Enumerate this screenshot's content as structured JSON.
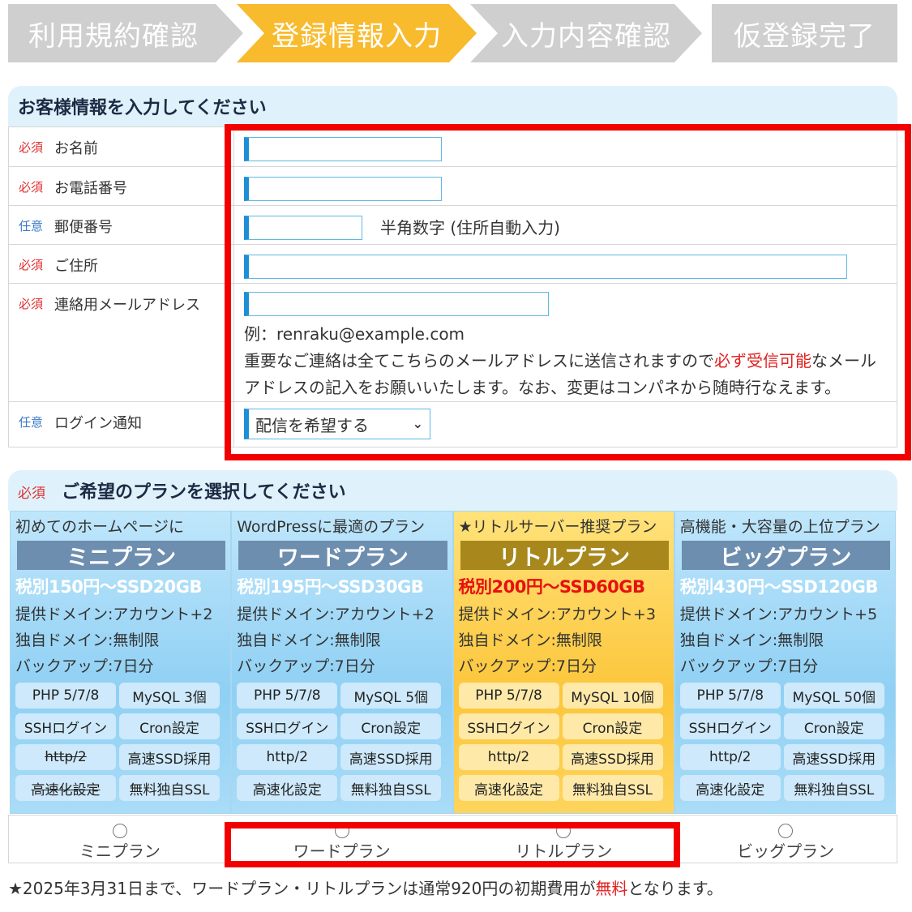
{
  "steps": [
    {
      "label": "利用規約確認"
    },
    {
      "label": "登録情報入力"
    },
    {
      "label": "入力内容確認"
    },
    {
      "label": "仮登録完了"
    }
  ],
  "customer_section": {
    "title": "お客様情報を入力してください",
    "fields": [
      {
        "tag": "必須",
        "label": "お名前"
      },
      {
        "tag": "必須",
        "label": "お電話番号"
      },
      {
        "tag": "任意",
        "label": "郵便番号",
        "hint": "半角数字 (住所自動入力)"
      },
      {
        "tag": "必須",
        "label": "ご住所"
      },
      {
        "tag": "必須",
        "label": "連絡用メールアドレス",
        "example": "例：renraku@example.com",
        "note_a": "重要なご連絡は全てこちらのメールアドレスに送信されますので",
        "note_red": "必ず受信可能",
        "note_b": "なメール",
        "note_c": "アドレスの記入をお願いいたします。なお、変更はコンパネから随時行なえます。"
      },
      {
        "tag": "任意",
        "label": "ログイン通知",
        "select_value": "配信を希望する"
      }
    ]
  },
  "plan_section": {
    "tag": "必須",
    "title": "ご希望のプランを選択してください",
    "plans": [
      {
        "subtitle": "初めてのホームページに",
        "name": "ミニプラン",
        "price": "税別150円～SSD20GB",
        "domains": "提供ドメイン:アカウント+2",
        "own_domain": "独自ドメイン:無制限",
        "backup": "バックアップ:7日分",
        "features": [
          "PHP 5/7/8",
          "MySQL 3個",
          "SSHログイン",
          "Cron設定",
          "http/2",
          "高速SSD採用",
          "高速化設定",
          "無料独自SSL"
        ],
        "radio_label": "ミニプラン"
      },
      {
        "subtitle": "WordPressに最適のプラン",
        "name": "ワードプラン",
        "price": "税別195円～SSD30GB",
        "domains": "提供ドメイン:アカウント+2",
        "own_domain": "独自ドメイン:無制限",
        "backup": "バックアップ:7日分",
        "features": [
          "PHP 5/7/8",
          "MySQL 5個",
          "SSHログイン",
          "Cron設定",
          "http/2",
          "高速SSD採用",
          "高速化設定",
          "無料独自SSL"
        ],
        "radio_label": "ワードプラン"
      },
      {
        "subtitle": "★リトルサーバー推奨プラン",
        "name": "リトルプラン",
        "price": "税別200円～SSD60GB",
        "domains": "提供ドメイン:アカウント+3",
        "own_domain": "独自ドメイン:無制限",
        "backup": "バックアップ:7日分",
        "features": [
          "PHP 5/7/8",
          "MySQL 10個",
          "SSHログイン",
          "Cron設定",
          "http/2",
          "高速SSD採用",
          "高速化設定",
          "無料独自SSL"
        ],
        "radio_label": "リトルプラン"
      },
      {
        "subtitle": "高機能・大容量の上位プラン",
        "name": "ビッグプラン",
        "price": "税別430円～SSD120GB",
        "domains": "提供ドメイン:アカウント+5",
        "own_domain": "独自ドメイン:無制限",
        "backup": "バックアップ:7日分",
        "features": [
          "PHP 5/7/8",
          "MySQL 50個",
          "SSHログイン",
          "Cron設定",
          "http/2",
          "高速SSD採用",
          "高速化設定",
          "無料独自SSL"
        ],
        "radio_label": "ビッグプラン"
      }
    ],
    "footnote_a": "★2025年3月31日まで、ワードプラン・リトルプランは通常920円の初期費用が",
    "footnote_red": "無料",
    "footnote_b": "となります。"
  },
  "colors": {
    "step_active": "#f8bb2e",
    "step_inactive": "#cfcfcf",
    "highlight": "#f20000",
    "required": "#e03030",
    "optional": "#3a78c8"
  }
}
